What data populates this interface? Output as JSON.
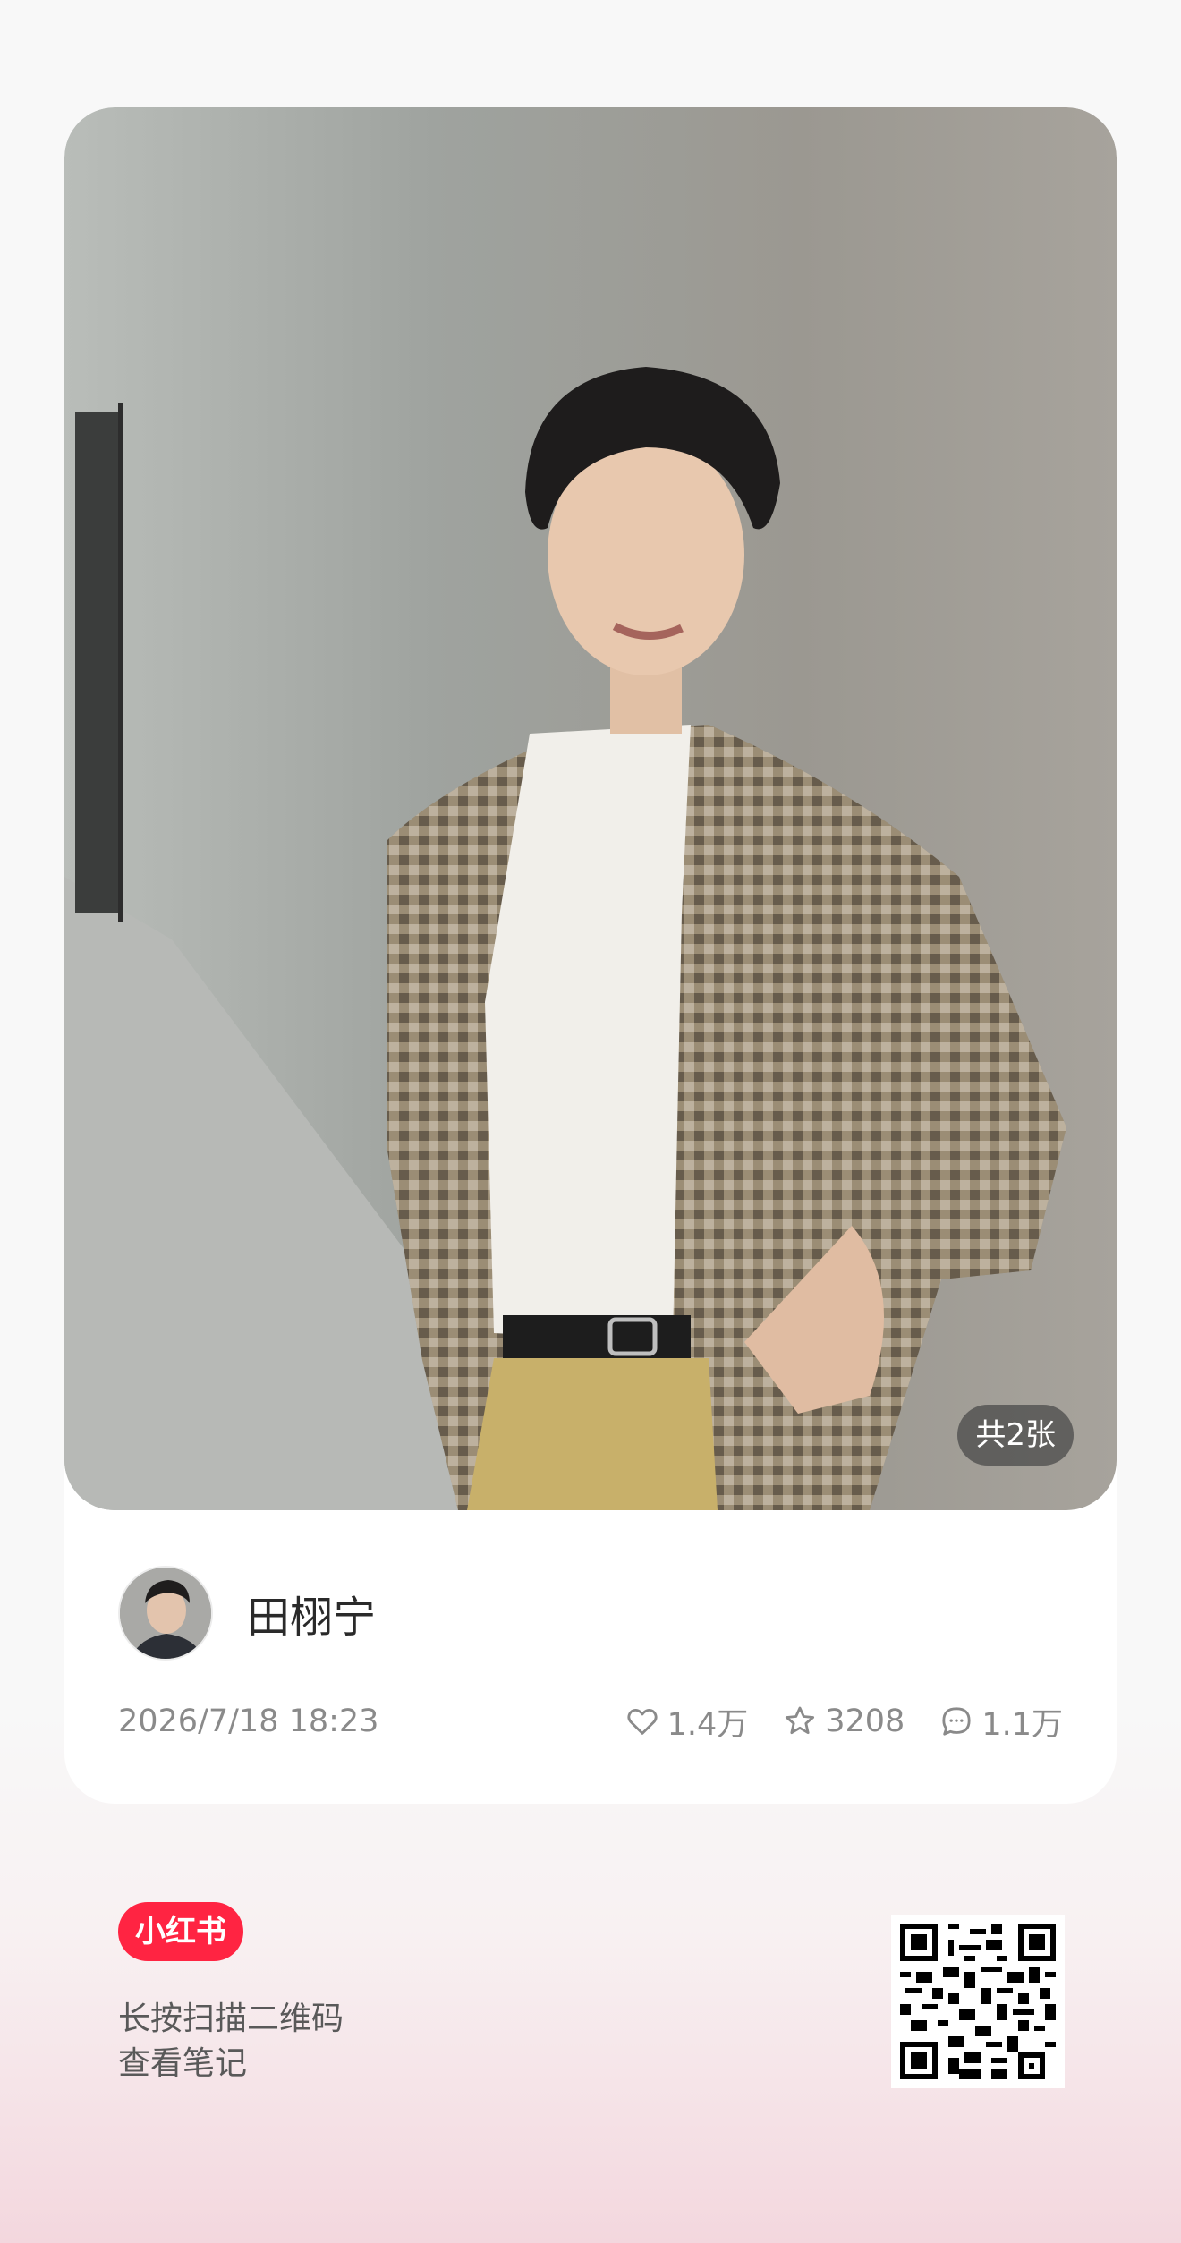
{
  "post": {
    "image_count_label": "共2张",
    "author_name": "田栩宁",
    "date": "2026/7/18 18:23",
    "stats": {
      "likes": "1.4万",
      "collects": "3208",
      "comments": "1.1万"
    }
  },
  "footer": {
    "logo_text": "小红书",
    "hint_line1": "长按扫描二维码",
    "hint_line2": "查看笔记"
  },
  "colors": {
    "brand": "#ff2442"
  },
  "icons": [
    "heart-icon",
    "star-icon",
    "comment-icon",
    "qr-code"
  ]
}
